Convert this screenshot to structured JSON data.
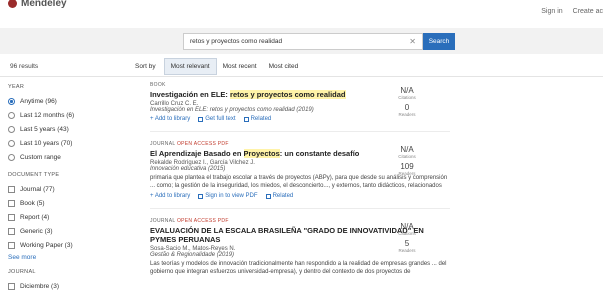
{
  "app": {
    "name": "Mendeley"
  },
  "top_links": [
    "Sign in",
    "Create ac"
  ],
  "search": {
    "value": "retos y proyectos como realidad",
    "button": "Search"
  },
  "results_count": "96 results",
  "sort": {
    "label": "Sort by",
    "options": [
      "Most relevant",
      "Most recent",
      "Most cited"
    ]
  },
  "facets": {
    "year": {
      "title": "YEAR",
      "options": [
        "Anytime (96)",
        "Last 12 months (6)",
        "Last 5 years (43)",
        "Last 10 years (70)",
        "Custom range"
      ]
    },
    "doctype": {
      "title": "DOCUMENT TYPE",
      "options": [
        "Journal (77)",
        "Book (5)",
        "Report (4)",
        "Generic (3)",
        "Working Paper (3)"
      ],
      "see_more": "See more"
    },
    "journal": {
      "title": "JOURNAL",
      "options": [
        "Diciembre (3)"
      ]
    }
  },
  "results": [
    {
      "type": "BOOK",
      "oa": "",
      "title_pre": "Investigación en ELE: ",
      "title_hl": "retos y proyectos como realidad",
      "title_post": "",
      "authors": "Carrillo Cruz C. E.",
      "journal": "Investigación en ELE: retos y proyectos como realidad (2019)",
      "snippet": "",
      "actions": [
        "+ Add to library",
        "Get full text",
        "Related"
      ],
      "citations": "N/A",
      "citations_label": "Citations",
      "readers": "0",
      "readers_label": "Readers"
    },
    {
      "type": "JOURNAL ",
      "oa": "OPEN ACCESS PDF",
      "title_pre": "El Aprendizaje Basado en ",
      "title_hl": "Proyectos",
      "title_post": ": un constante desafío",
      "authors": "Rekalde Rodríguez I., García Vilchez J.",
      "journal": "Innovación educativa (2015)",
      "snippet": "primaria que plantea el trabajo escolar a través de proyectos (ABPy), para que desde su análisis y comprensión ... como; la gestión de la inseguridad, los miedos, el desconcierto..., y externos, tanto didácticos, relacionados",
      "actions": [
        "+ Add to library",
        "Sign in to view PDF",
        "Related"
      ],
      "citations": "N/A",
      "citations_label": "Citations",
      "readers": "109",
      "readers_label": "Readers"
    },
    {
      "type": "JOURNAL ",
      "oa": "OPEN ACCESS PDF",
      "title_pre": "EVALUACIÓN DE LA ESCALA BRASILEÑA \"GRADO DE INNOVATIVIDAD\" EN PYMES PERUANAS",
      "title_hl": "",
      "title_post": "",
      "authors": "Sosa-Sacio M., Matos-Reyes N.",
      "journal": "Gestão & Regionalidade (2019)",
      "snippet": "Las teorías y modelos de innovación tradicionalmente han respondido a la realidad de empresas grandes ... del gobierno que integran esfuerzos universidad-empresa), y dentro del contexto de dos proyectos de",
      "actions": [],
      "citations": "N/A",
      "citations_label": "Citations",
      "readers": "5",
      "readers_label": "Readers"
    }
  ],
  "colors": {
    "accent": "#2a6ebb",
    "highlight": "#fff3a8",
    "oa": "#c0392b"
  }
}
